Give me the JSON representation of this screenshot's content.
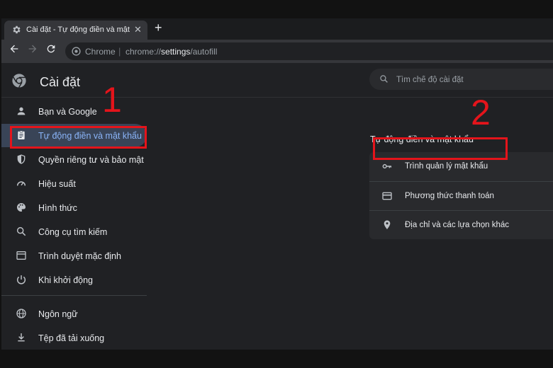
{
  "tab": {
    "title": "Cài đặt - Tự động điền và mật khẩu",
    "close": "✕",
    "new_tab": "+"
  },
  "toolbar": {
    "site_label": "Chrome",
    "separator": "|",
    "url_scheme": "chrome://",
    "url_host": "settings",
    "url_path": "/autofill"
  },
  "header": {
    "app_title": "Cài đặt",
    "search_placeholder": "Tìm chế độ cài đặt"
  },
  "sidebar": {
    "items": [
      {
        "label": "Bạn và Google",
        "icon": "person-icon"
      },
      {
        "label": "Tự động điền và mật khẩu",
        "icon": "clipboard-icon",
        "active": true
      },
      {
        "label": "Quyền riêng tư và bảo mật",
        "icon": "shield-icon"
      },
      {
        "label": "Hiệu suất",
        "icon": "speedometer-icon"
      },
      {
        "label": "Hình thức",
        "icon": "palette-icon"
      },
      {
        "label": "Công cụ tìm kiếm",
        "icon": "search-icon"
      },
      {
        "label": "Trình duyệt mặc định",
        "icon": "browser-icon"
      },
      {
        "label": "Khi khởi động",
        "icon": "power-icon"
      },
      {
        "label": "Ngôn ngữ",
        "icon": "globe-icon"
      },
      {
        "label": "Tệp đã tải xuống",
        "icon": "download-icon"
      }
    ]
  },
  "main": {
    "section_title": "Tự động điền và mật khẩu",
    "rows": [
      {
        "label": "Trình quản lý mật khẩu",
        "icon": "key-icon"
      },
      {
        "label": "Phương thức thanh toán",
        "icon": "credit-card-icon"
      },
      {
        "label": "Địa chỉ và các lựa chọn khác",
        "icon": "location-pin-icon"
      }
    ]
  },
  "annotations": {
    "step1": "1",
    "step2": "2",
    "highlight_color": "#e4141b"
  },
  "colors": {
    "background": "#202124",
    "accent": "#8ab4f8",
    "active_bg": "#394457"
  }
}
